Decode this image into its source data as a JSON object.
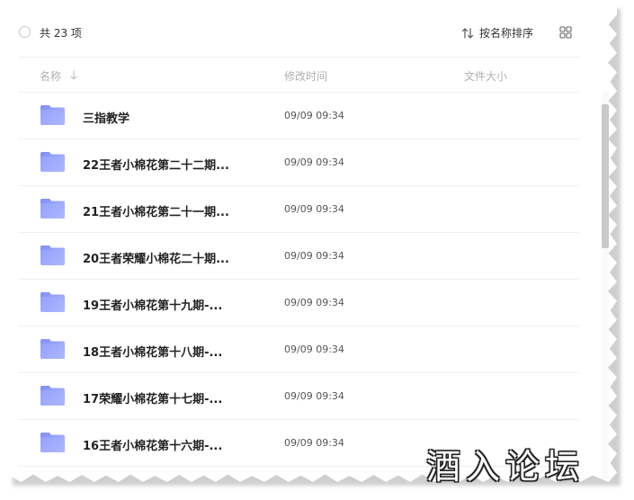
{
  "toolbar": {
    "count_label": "共 23 项",
    "sort_label": "按名称排序",
    "sort_icon": "sort-arrows-icon",
    "view_icon": "grid-view-icon"
  },
  "columns": {
    "name": "名称",
    "modified": "修改时间",
    "size": "文件大小"
  },
  "files": [
    {
      "name": "三指教学",
      "modified": "09/09 09:34",
      "icon": "folder-icon"
    },
    {
      "name": "22王者小棉花第二十二期...",
      "modified": "09/09 09:34",
      "icon": "folder-icon"
    },
    {
      "name": "21王者小棉花第二十一期...",
      "modified": "09/09 09:34",
      "icon": "folder-icon"
    },
    {
      "name": "20王者荣耀小棉花二十期...",
      "modified": "09/09 09:34",
      "icon": "folder-icon"
    },
    {
      "name": "19王者小棉花第十九期-...",
      "modified": "09/09 09:34",
      "icon": "folder-icon"
    },
    {
      "name": "18王者小棉花第十八期-...",
      "modified": "09/09 09:34",
      "icon": "folder-icon"
    },
    {
      "name": "17荣耀小棉花第十七期-...",
      "modified": "09/09 09:34",
      "icon": "folder-icon"
    },
    {
      "name": "16王者小棉花第十六期-...",
      "modified": "09/09 09:34",
      "icon": "folder-icon"
    }
  ],
  "watermark": "酒入论坛",
  "colors": {
    "folder_light": "#aab4ff",
    "folder_dark": "#7f8df5",
    "text": "#222222",
    "muted": "#b0b0b0"
  }
}
